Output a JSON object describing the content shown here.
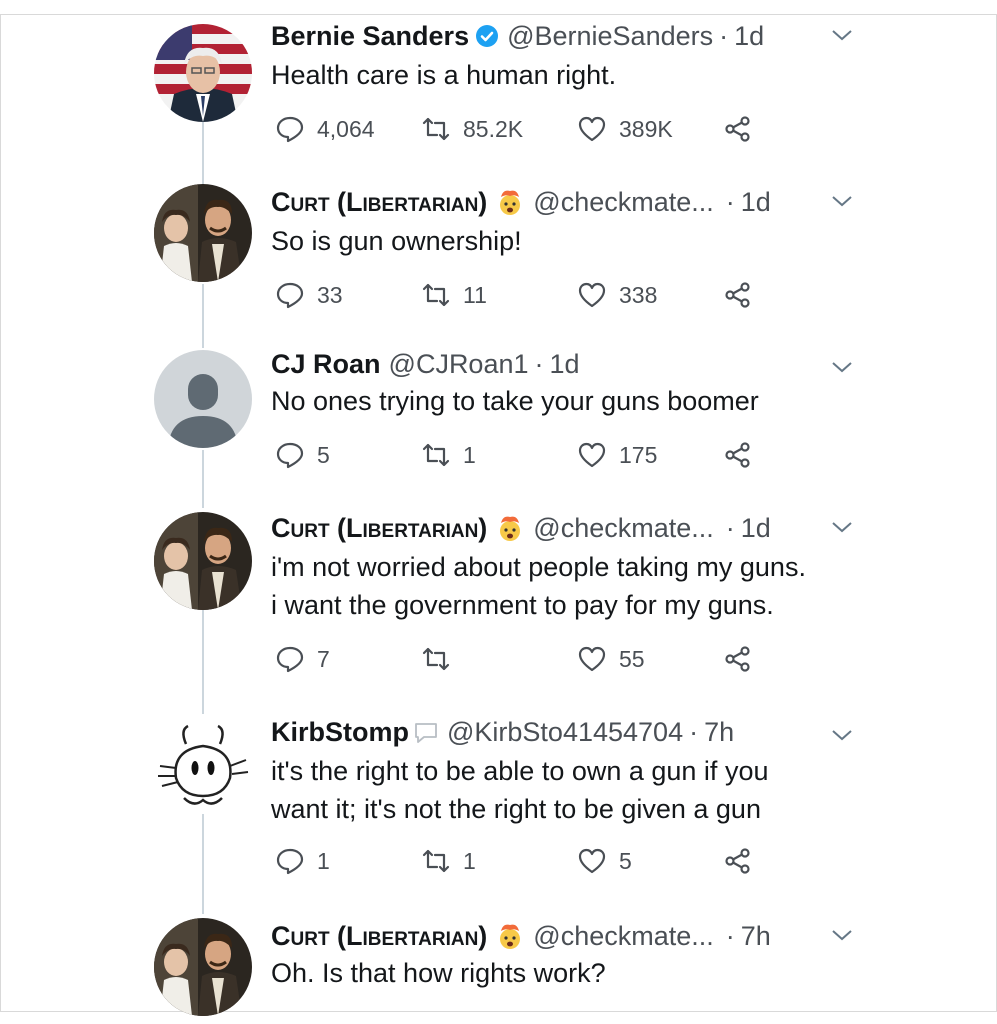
{
  "tweets": [
    {
      "name": "Bernie Sanders",
      "handle": "@BernieSanders",
      "time": "1d",
      "lines": [
        "Health care is a human right."
      ],
      "replies": "4,064",
      "retweets": "85.2K",
      "likes": "389K"
    },
    {
      "name": "Curt (Libertarian)",
      "handle": "@checkmate...",
      "time": "1d",
      "lines": [
        "So is gun ownership!"
      ],
      "replies": "33",
      "retweets": "11",
      "likes": "338"
    },
    {
      "name": "CJ Roan",
      "handle": "@CJRoan1",
      "time": "1d",
      "lines": [
        "No ones trying to take your guns boomer"
      ],
      "replies": "5",
      "retweets": "1",
      "likes": "175"
    },
    {
      "name": "Curt (Libertarian)",
      "handle": "@checkmate...",
      "time": "1d",
      "lines": [
        "i'm not worried about people taking my guns.",
        "i want the government to pay for my guns."
      ],
      "replies": "7",
      "retweets": "",
      "likes": "55"
    },
    {
      "name": "KirbStomp",
      "handle": "@KirbSto41454704",
      "time": "7h",
      "lines": [
        "it's the right to be able to own a gun if you",
        "want it; it's not the right to be given a gun"
      ],
      "replies": "1",
      "retweets": "1",
      "likes": "5"
    },
    {
      "name": "Curt (Libertarian)",
      "handle": "@checkmate...",
      "time": "7h",
      "lines": [
        "Oh. Is that how rights work?"
      ],
      "replies": "",
      "retweets": "",
      "likes": ""
    }
  ],
  "icons": {
    "reply": "reply-icon",
    "retweet": "retweet-icon",
    "like": "heart-icon",
    "share": "share-icon",
    "more": "chevron-down-icon",
    "verified": "verified-badge-icon",
    "emoji": "exploding-head-emoji"
  },
  "colors": {
    "verified": "#1da1f2",
    "text": "#14171a",
    "secondary": "#4a4f55",
    "thread_line": "#ccd6dd"
  }
}
